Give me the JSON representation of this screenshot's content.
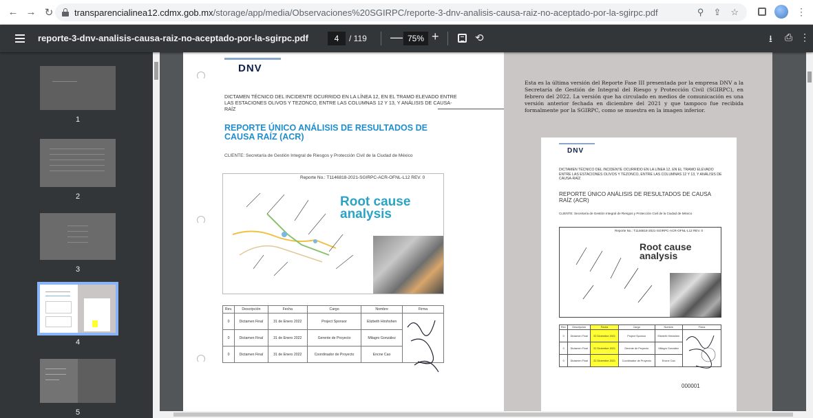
{
  "browser": {
    "back_icon": "arrow-left-icon",
    "url_host": "transparencialinea12.cdmx.gob.mx",
    "url_path": "/storage/app/media/Observaciones%20SGIRPC/reporte-3-dnv-analisis-causa-raiz-no-aceptado-por-la-sgirpc.pdf"
  },
  "toolbar": {
    "title": "reporte-3-dnv-analisis-causa-raiz-no-aceptado-por-la-sgirpc.pdf",
    "current_page": "4",
    "total_pages": "/ 119",
    "zoom": "75%",
    "minus_label": "—",
    "plus_label": "+"
  },
  "thumbnails": [
    {
      "label": "1"
    },
    {
      "label": "2"
    },
    {
      "label": "3"
    },
    {
      "label": "4",
      "selected": true
    },
    {
      "label": "5"
    }
  ],
  "left_page": {
    "logo": "DNV",
    "dictamen": "DICTAMEN TÉCNICO DEL INCIDENTE OCURRIDO EN LA LÍNEA 12, EN EL TRAMO ELEVADO ENTRE LAS ESTACIONES OLIVOS Y TEZONCO, ENTRE LAS COLUMNAS 12 Y 13, Y ANÁLISIS DE CAUSA-RAÍZ",
    "title": "REPORTE ÚNICO ANÁLISIS DE RESULTADOS DE CAUSA RAÍZ (ACR)",
    "cliente": "CLIENTE: Secretaría de Gestión Integral de Riesgos y Protección Civil de la Ciudad de México",
    "reporte_no": "Reporte No.: T1146818-2021-SGIRPC-ACR-OFNL-L12 REV. 0",
    "rca_line1": "Root cause",
    "rca_line2": "analysis",
    "table": {
      "headers": [
        "Rev.",
        "Descripción",
        "Fecha",
        "Cargo",
        "Nombre",
        "Firma"
      ],
      "rows": [
        [
          "0",
          "Dictamen Final",
          "31 de Enero 2022",
          "Project Sponsor",
          "Elizbeth Hirshshen",
          ""
        ],
        [
          "0",
          "Dictamen Final",
          "31 de Enero 2022",
          "Gerente de Proyecto",
          "Milagro González",
          ""
        ],
        [
          "0",
          "Dictamen Final",
          "31 de Enero 2022",
          "Coordinador de Proyecto",
          "Encne Cao",
          ""
        ]
      ]
    }
  },
  "right_page": {
    "paragraph": "Esta es la última versión del Reporte Fase III presentada por la empresa DNV a la Secretaría de Gestión de Integral del Riesgo y Protección Civil (SGIRPC), en febrero del 2022. La versión que ha circulado en medios de comunicación es una versión anterior fechada en diciembre del 2021 y que tampoco fue recibida formalmente por la SGIRPC, como se muestra en la imagen inferior.",
    "inner_logo": "DNV",
    "inner_dictamen": "DICTAMEN TÉCNICO DEL INCIDENTE OCURRIDO EN LA LÍNEA 12, EN EL TRAMO ELEVADO ENTRE LAS ESTACIONES OLIVOS Y TEZONCO, ENTRE LAS COLUMNAS 12 Y 13, Y ANÁLISIS DE CAUSA-RAÍZ",
    "inner_title": "REPORTE ÚNICO ANÁLISIS DE RESULTADOS DE CAUSA RAÍZ (ACR)",
    "inner_cliente": "CLIENTE: Secretaría de Gestión Integral de Riesgos y Protección Civil de la Ciudad de México",
    "inner_reporte_no": "Reporte No.: T1146818-2021-SGIRPC-ACR-OFNL-L12 REV. 0",
    "inner_rca_line1": "Root cause",
    "inner_rca_line2": "analysis",
    "inner_table": {
      "headers": [
        "Rev.",
        "Descripción",
        "Fecha",
        "Cargo",
        "Nombre",
        "Firma"
      ],
      "rows": [
        [
          "0",
          "Dictamen Final",
          "22 Diciembre 2021",
          "Project Sponsor",
          "Elizbeth Hirshshen",
          ""
        ],
        [
          "0",
          "Dictamen Final",
          "22 Diciembre 2021",
          "Gerente de Proyecto",
          "Milagro González",
          ""
        ],
        [
          "0",
          "Dictamen Final",
          "22 Diciembre 2021",
          "Coordinador de Proyecto",
          "Encne Cao",
          ""
        ]
      ]
    },
    "folio": "000001",
    "highlight_color": "#ffff33"
  }
}
